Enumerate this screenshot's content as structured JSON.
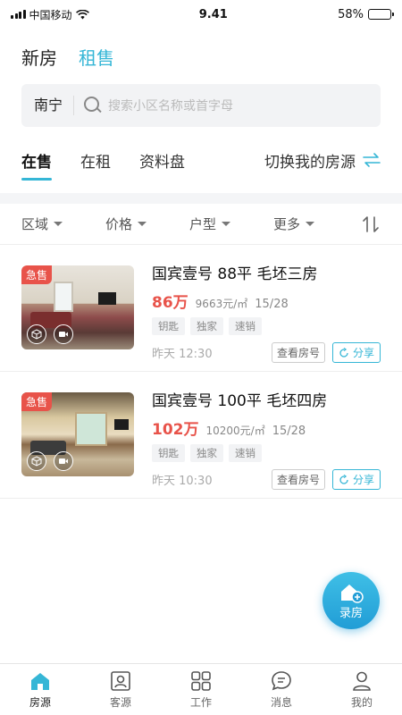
{
  "status_bar": {
    "carrier": "中国移动",
    "time": "9.41",
    "battery": "58%",
    "battery_level": 0.58
  },
  "top_tabs": [
    {
      "label": "新房"
    },
    {
      "label": "租售"
    }
  ],
  "search": {
    "city": "南宁",
    "placeholder": "搜索小区名称或首字母"
  },
  "sub_tabs": [
    {
      "label": "在售"
    },
    {
      "label": "在租"
    },
    {
      "label": "资料盘"
    }
  ],
  "switch_label": "切换我的房源",
  "filters": [
    {
      "label": "区域"
    },
    {
      "label": "价格"
    },
    {
      "label": "户型"
    },
    {
      "label": "更多"
    }
  ],
  "listings": [
    {
      "badge": "急售",
      "title": "国宾壹号 88平 毛坯三房",
      "price": "86万",
      "unit_price": "9663元/㎡",
      "floor": "15/28",
      "tags": [
        "钥匙",
        "独家",
        "速销"
      ],
      "time": "昨天 12:30",
      "view_label": "查看房号",
      "share_label": "分享"
    },
    {
      "badge": "急售",
      "title": "国宾壹号 100平 毛坯四房",
      "price": "102万",
      "unit_price": "10200元/㎡",
      "floor": "15/28",
      "tags": [
        "钥匙",
        "独家",
        "速销"
      ],
      "time": "昨天 10:30",
      "view_label": "查看房号",
      "share_label": "分享"
    }
  ],
  "fab_label": "录房",
  "tabbar": [
    {
      "label": "房源"
    },
    {
      "label": "客源"
    },
    {
      "label": "工作"
    },
    {
      "label": "消息"
    },
    {
      "label": "我的"
    }
  ],
  "colors": {
    "accent": "#35b6d6",
    "price": "#e8534a"
  }
}
